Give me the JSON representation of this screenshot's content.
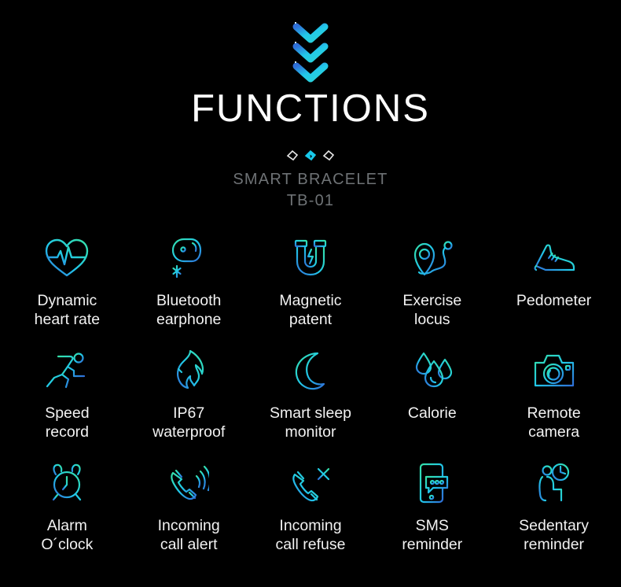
{
  "page": {
    "background_color": "#000000",
    "title": "FUNCTIONS",
    "title_color": "#ffffff",
    "subtitle_line1": "SMART BRACELET",
    "subtitle_line2": "TB-01",
    "subtitle_color": "#6e7275",
    "accent_color_start": "#3ed8b0",
    "accent_color_end": "#2f7fd8",
    "accent_cyan": "#25cdf0",
    "label_color": "#f2f2f2"
  },
  "decorations": {
    "chevron_icon": "chevron-down-icon",
    "chevron_count": 3,
    "diamond_icon": "diamond-icon",
    "diamond_count": 3,
    "diamond_active_index": 1
  },
  "features": [
    {
      "icon": "heart-rate-icon",
      "label": "Dynamic\nheart rate"
    },
    {
      "icon": "bluetooth-earphone-icon",
      "label": "Bluetooth\nearphone"
    },
    {
      "icon": "magnet-icon",
      "label": "Magnetic\npatent"
    },
    {
      "icon": "location-route-icon",
      "label": "Exercise\nlocus"
    },
    {
      "icon": "sneaker-icon",
      "label": "Pedometer"
    },
    {
      "icon": "running-person-icon",
      "label": "Speed\nrecord"
    },
    {
      "icon": "flame-icon",
      "label": "IP67\nwaterproof"
    },
    {
      "icon": "crescent-moon-icon",
      "label": "Smart sleep\nmonitor"
    },
    {
      "icon": "water-drops-icon",
      "label": "Calorie"
    },
    {
      "icon": "camera-icon",
      "label": "Remote\ncamera"
    },
    {
      "icon": "alarm-clock-icon",
      "label": "Alarm\nO´clock"
    },
    {
      "icon": "incoming-call-icon",
      "label": "Incoming\ncall alert"
    },
    {
      "icon": "call-refuse-icon",
      "label": "Incoming\ncall refuse"
    },
    {
      "icon": "sms-phone-icon",
      "label": "SMS\nreminder"
    },
    {
      "icon": "sedentary-person-icon",
      "label": "Sedentary\nreminder"
    }
  ]
}
